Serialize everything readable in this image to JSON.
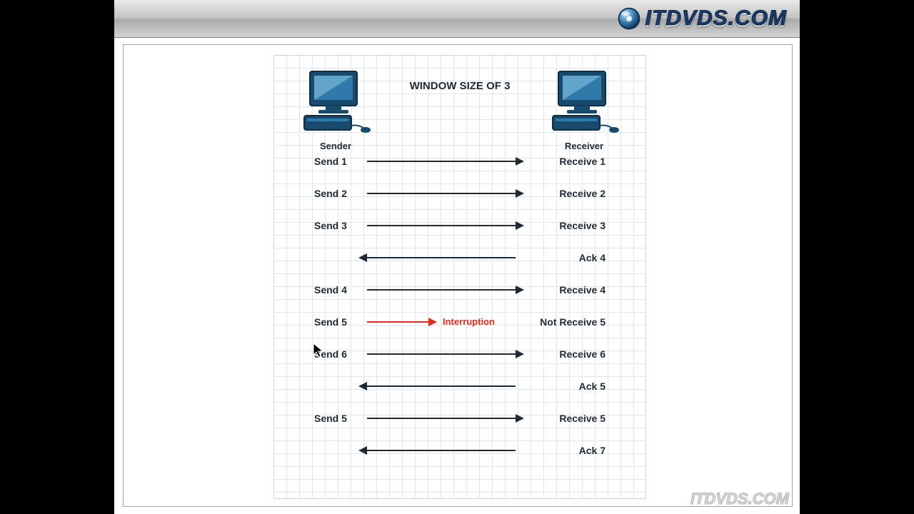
{
  "brand": "ITDVDS.COM",
  "watermark": "ITDVDS.COM",
  "diagram": {
    "title": "WINDOW SIZE OF 3",
    "sender_label": "Sender",
    "receiver_label": "Receiver",
    "interruption_label": "Interruption",
    "rows": [
      {
        "type": "send",
        "left": "Send 1",
        "right": "Receive 1"
      },
      {
        "type": "send",
        "left": "Send 2",
        "right": "Receive 2"
      },
      {
        "type": "send",
        "left": "Send 3",
        "right": "Receive 3"
      },
      {
        "type": "ack",
        "right": "Ack 4"
      },
      {
        "type": "send",
        "left": "Send 4",
        "right": "Receive 4"
      },
      {
        "type": "interrupt",
        "left": "Send 5",
        "right": "Not Receive 5"
      },
      {
        "type": "send",
        "left": "Send 6",
        "right": "Receive 6"
      },
      {
        "type": "ack",
        "right": "Ack 5"
      },
      {
        "type": "send",
        "left": "Send 5",
        "right": "Receive 5"
      },
      {
        "type": "ack",
        "right": "Ack 7"
      }
    ]
  }
}
